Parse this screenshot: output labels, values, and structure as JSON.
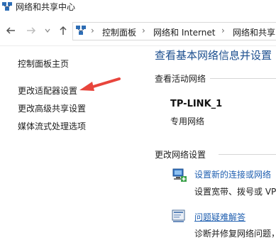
{
  "window": {
    "title": "网络和共享中心"
  },
  "nav": {
    "breadcrumbs": [
      "控制面板",
      "网络和 Internet",
      "网络和共享"
    ]
  },
  "left_pane": {
    "items": [
      {
        "label": "控制面板主页"
      },
      {
        "label": "更改适配器设置"
      },
      {
        "label": "更改高级共享设置"
      },
      {
        "label": "媒体流式处理选项"
      }
    ]
  },
  "main": {
    "title": "查看基本网络信息并设置",
    "active_networks_label": "查看活动网络",
    "network": {
      "name": "TP-LINK_1",
      "type": "专用网络"
    },
    "change_settings_label": "更改网络设置",
    "tasks": [
      {
        "link": "设置新的连接或网络",
        "description": "设置宽带、拨号或 VP",
        "icon": "new-connection-icon"
      },
      {
        "link": "问题疑难解答",
        "description": "诊断并修复网络问题，",
        "icon": "troubleshoot-icon"
      }
    ]
  },
  "annotation": {
    "arrow_color": "#e8453c"
  }
}
